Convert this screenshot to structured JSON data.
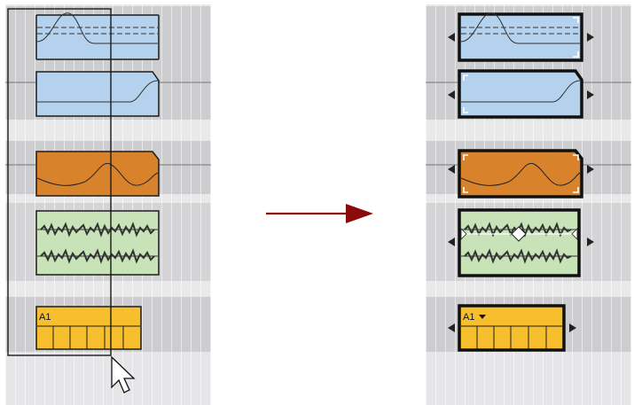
{
  "left_panel": {
    "tracks": [
      {
        "kind": "automation",
        "color": "#b4d2ee"
      },
      {
        "kind": "automation",
        "color": "#b4d2ee"
      },
      {
        "kind": "automation",
        "color": "#d9822c"
      },
      {
        "kind": "audio",
        "color": "#c8e3b8"
      },
      {
        "kind": "pattern",
        "color": "#f7bf2d",
        "label": "A1"
      }
    ],
    "cursor_icon": "mouse-pointer-icon"
  },
  "transition_arrow": {
    "icon": "right-arrow-icon",
    "color": "#8b0a0a"
  },
  "right_panel": {
    "selected": true,
    "handle_icons": [
      "left-triangle-icon",
      "right-triangle-icon"
    ],
    "pattern_label": "A1"
  }
}
